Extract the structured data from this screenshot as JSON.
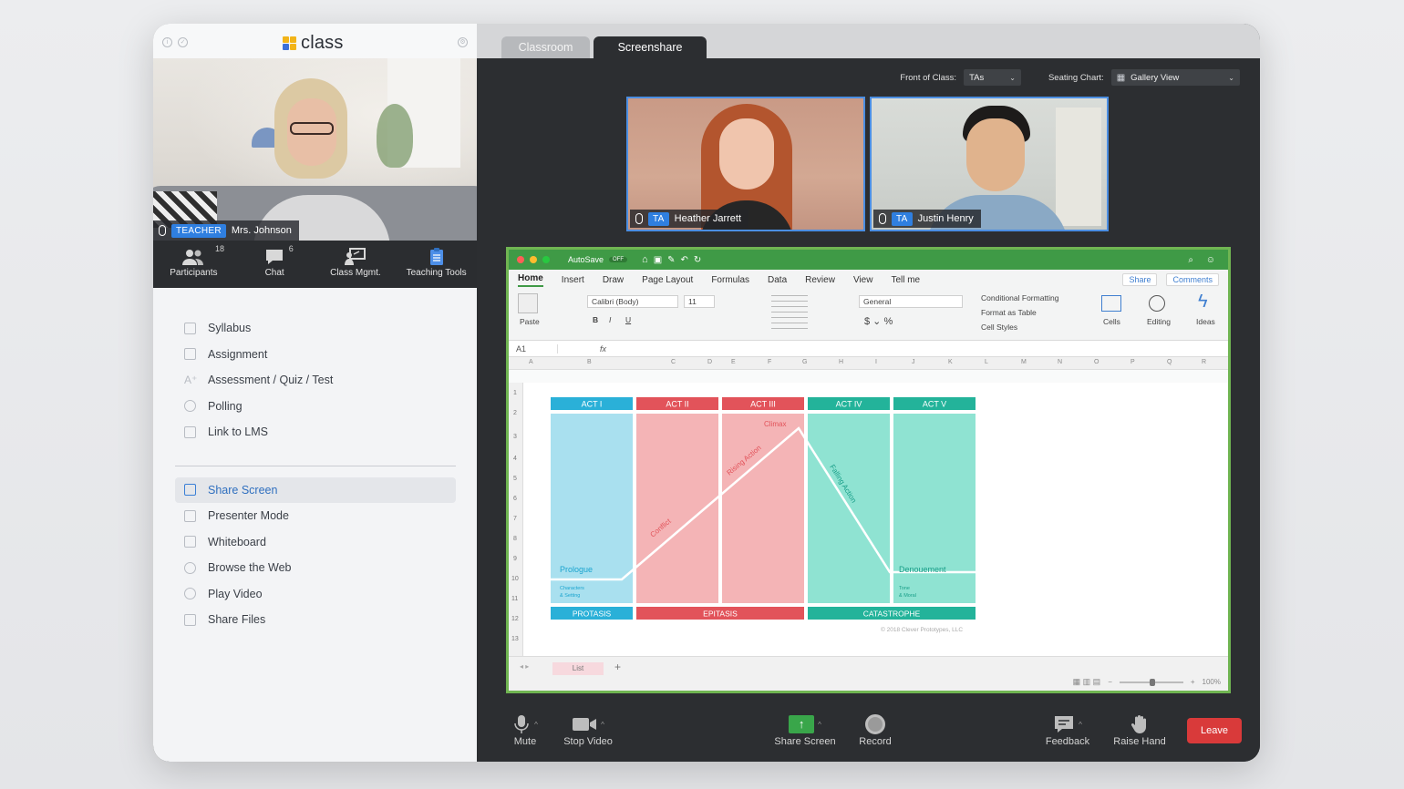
{
  "brand": {
    "name": "class"
  },
  "teacher": {
    "role": "TEACHER",
    "name": "Mrs. Johnson"
  },
  "left_tools": [
    {
      "label": "Participants",
      "count": "18",
      "icon": "participants-icon"
    },
    {
      "label": "Chat",
      "count": "6",
      "icon": "chat-icon"
    },
    {
      "label": "Class Mgmt.",
      "count": "",
      "icon": "class-management-icon"
    },
    {
      "label": "Teaching Tools",
      "count": "",
      "icon": "teaching-tools-icon"
    }
  ],
  "menu_top": [
    {
      "label": "Syllabus",
      "icon": "document-icon"
    },
    {
      "label": "Assignment",
      "icon": "assignment-icon"
    },
    {
      "label": "Assessment / Quiz / Test",
      "icon": "grade-icon"
    },
    {
      "label": "Polling",
      "icon": "check-circle-icon"
    },
    {
      "label": "Link to LMS",
      "icon": "external-link-icon"
    }
  ],
  "menu_bottom": [
    {
      "label": "Share Screen",
      "icon": "share-screen-icon",
      "active": true
    },
    {
      "label": "Presenter Mode",
      "icon": "presenter-icon"
    },
    {
      "label": "Whiteboard",
      "icon": "whiteboard-icon"
    },
    {
      "label": "Browse the Web",
      "icon": "globe-icon"
    },
    {
      "label": "Play Video",
      "icon": "play-icon"
    },
    {
      "label": "Share Files",
      "icon": "file-icon"
    }
  ],
  "tabs": {
    "classroom": "Classroom",
    "screenshare": "Screenshare"
  },
  "seating": {
    "front_label": "Front of Class:",
    "front_value": "TAs",
    "chart_label": "Seating Chart:",
    "chart_value": "Gallery View"
  },
  "students": [
    {
      "role": "TA",
      "name": "Heather Jarrett"
    },
    {
      "role": "TA",
      "name": "Justin Henry"
    }
  ],
  "excel": {
    "autosave": "AutoSave",
    "autosave_state": "OFF",
    "menu": [
      "Home",
      "Insert",
      "Draw",
      "Page Layout",
      "Formulas",
      "Data",
      "Review",
      "View",
      "Tell me"
    ],
    "share": "Share",
    "comments": "Comments",
    "ribbon": {
      "paste": "Paste",
      "font": "Calibri (Body)",
      "size": "11",
      "number_format": "General",
      "cond_format": "Conditional Formatting",
      "format_table": "Format as Table",
      "cell_styles": "Cell Styles",
      "cells": "Cells",
      "editing": "Editing",
      "ideas": "Ideas"
    },
    "cell_ref": "A1",
    "fx": "fx",
    "columns": [
      "A",
      "B",
      "C",
      "D",
      "E",
      "F",
      "G",
      "H",
      "I",
      "J",
      "K",
      "L",
      "M",
      "N",
      "O",
      "P",
      "Q",
      "R"
    ],
    "rows": [
      "1",
      "2",
      "3",
      "4",
      "5",
      "6",
      "7",
      "8",
      "9",
      "10",
      "11",
      "12",
      "13"
    ],
    "acts": [
      "ACT I",
      "ACT II",
      "ACT III",
      "ACT IV",
      "ACT V"
    ],
    "phases": [
      "PROTASIS",
      "EPITASIS",
      "CATASTROPHE"
    ],
    "plot": {
      "prologue": "Prologue",
      "prologue_sub1": "Characters",
      "prologue_sub2": "& Setting",
      "conflict": "Conflict",
      "rising": "Rising Action",
      "climax": "Climax",
      "falling": "Falling Action",
      "denouement": "Denouement",
      "denouement_sub1": "Tone",
      "denouement_sub2": "& Moral",
      "copyright": "© 2018 Clever Prototypes, LLC"
    },
    "sheet_tab": "List",
    "zoom": "100%"
  },
  "controls": {
    "mute": "Mute",
    "stop_video": "Stop Video",
    "share_screen": "Share Screen",
    "record": "Record",
    "feedback": "Feedback",
    "raise_hand": "Raise Hand",
    "leave": "Leave"
  },
  "colors": {
    "accent": "#2f7fe0",
    "excel_green": "#3f9a46",
    "leave_red": "#d93a3a",
    "act_blue": "#2ab0d8",
    "act_red": "#e2535a",
    "act_teal": "#23b39a"
  }
}
